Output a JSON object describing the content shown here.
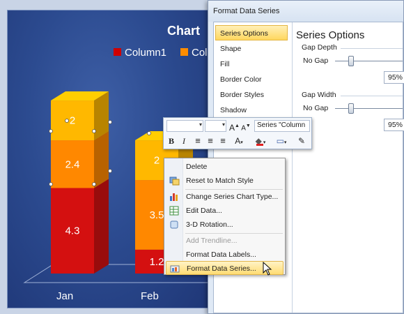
{
  "chart": {
    "title": "Chart",
    "legend": [
      {
        "label": "Column1",
        "color": "#d00000"
      },
      {
        "label": "Col",
        "color": "#ff8c00"
      }
    ],
    "categories": [
      "Jan",
      "Feb"
    ]
  },
  "chart_data": {
    "type": "bar",
    "stacked": true,
    "three_d": true,
    "title": "Chart",
    "categories": [
      "Jan",
      "Feb"
    ],
    "series": [
      {
        "name": "Column1",
        "color": "#d41010",
        "values": [
          4.3,
          1.2
        ]
      },
      {
        "color": "#ff8800",
        "values": [
          2.4,
          3.5
        ]
      },
      {
        "color": "#ffb800",
        "values": [
          2,
          2
        ]
      }
    ],
    "legend_position": "top"
  },
  "dialog": {
    "title": "Format Data Series",
    "nav": [
      "Series Options",
      "Shape",
      "Fill",
      "Border Color",
      "Border Styles",
      "Shadow"
    ],
    "selected_nav": "Series Options",
    "panel_title": "Series Options",
    "gap_depth": {
      "label": "Gap Depth",
      "caption": "No Gap",
      "value": "95%",
      "level": 0.19
    },
    "gap_width": {
      "label": "Gap Width",
      "caption": "No Gap",
      "value": "95%",
      "level": 0.19
    }
  },
  "mini_toolbar": {
    "series_selector": "Series \"Column",
    "buttons": [
      "grow-font",
      "shrink-font",
      "bold",
      "italic",
      "align-left",
      "center",
      "align-right",
      "font-color",
      "fill-color",
      "line-color",
      "format-painter"
    ]
  },
  "context_menu": {
    "items": [
      {
        "label": "Delete",
        "icon": "",
        "enabled": true
      },
      {
        "label": "Reset to Match Style",
        "icon": "reset-style-icon",
        "enabled": true
      },
      {
        "label": "Change Series Chart Type...",
        "icon": "chart-type-icon",
        "enabled": true
      },
      {
        "label": "Edit Data...",
        "icon": "edit-data-icon",
        "enabled": true
      },
      {
        "label": "3-D Rotation...",
        "icon": "rotation-icon",
        "enabled": true
      },
      {
        "label": "Add Trendline...",
        "icon": "",
        "enabled": false
      },
      {
        "label": "Format Data Labels...",
        "icon": "",
        "enabled": true
      },
      {
        "label": "Format Data Series...",
        "icon": "format-series-icon",
        "enabled": true,
        "highlighted": true
      }
    ]
  }
}
